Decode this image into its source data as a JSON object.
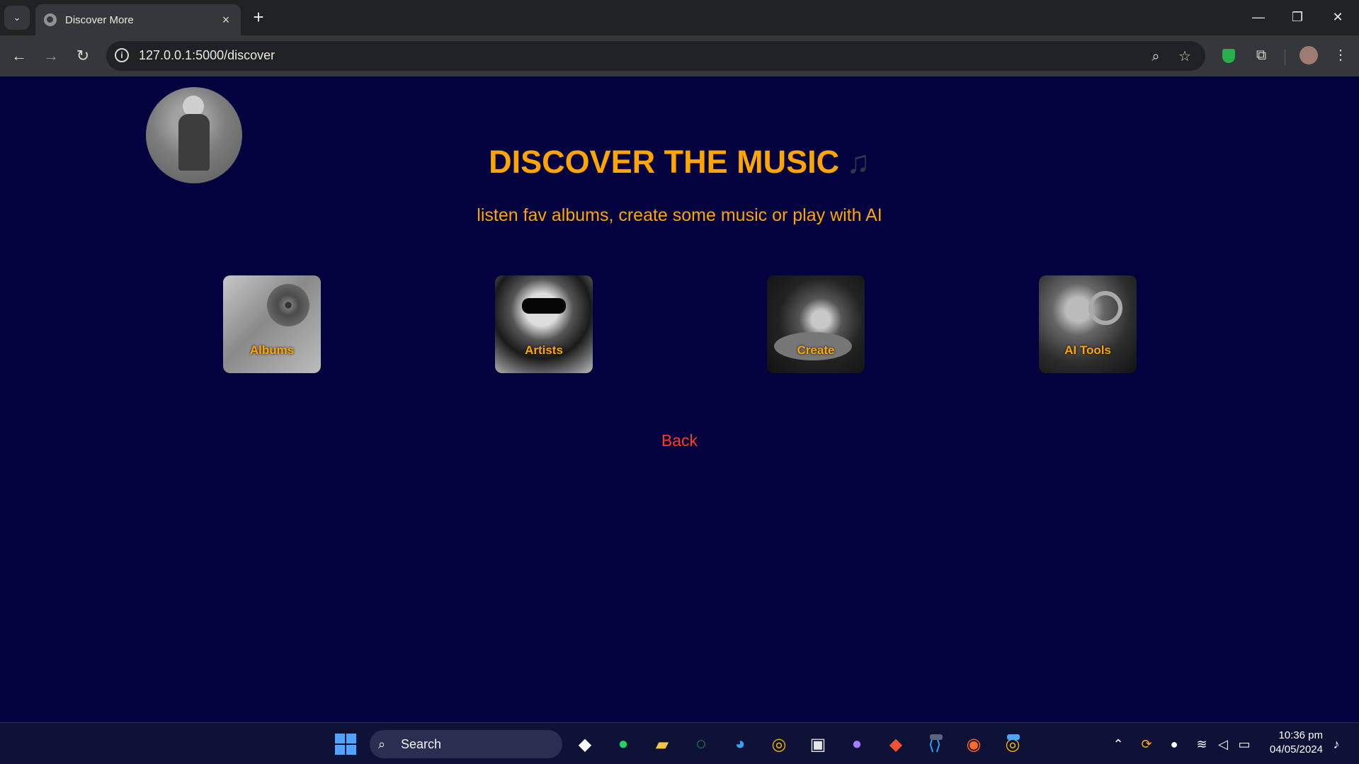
{
  "browser": {
    "tab_title": "Discover More",
    "url": "127.0.0.1:5000/discover",
    "window_controls": {
      "minimize": "—",
      "restore": "❐",
      "close": "✕"
    }
  },
  "page": {
    "headline": "DISCOVER THE MUSIC",
    "headline_icon": "♫",
    "subtitle": "listen fav albums, create some music or play with AI",
    "cards": [
      {
        "label": "Albums",
        "icon": "albums-card-image"
      },
      {
        "label": "Artists",
        "icon": "artists-card-image"
      },
      {
        "label": "Create",
        "icon": "create-card-image"
      },
      {
        "label": "AI Tools",
        "icon": "ai-tools-card-image"
      }
    ],
    "back_label": "Back"
  },
  "taskbar": {
    "search_label": "Search",
    "time": "10:36 pm",
    "date": "04/05/2024"
  },
  "colors": {
    "page_background": "#03023f",
    "accent_orange": "#ffa500",
    "back_link_red": "#ff3b1f",
    "browser_dark": "#1f2123",
    "taskbar": "#0e1237"
  }
}
